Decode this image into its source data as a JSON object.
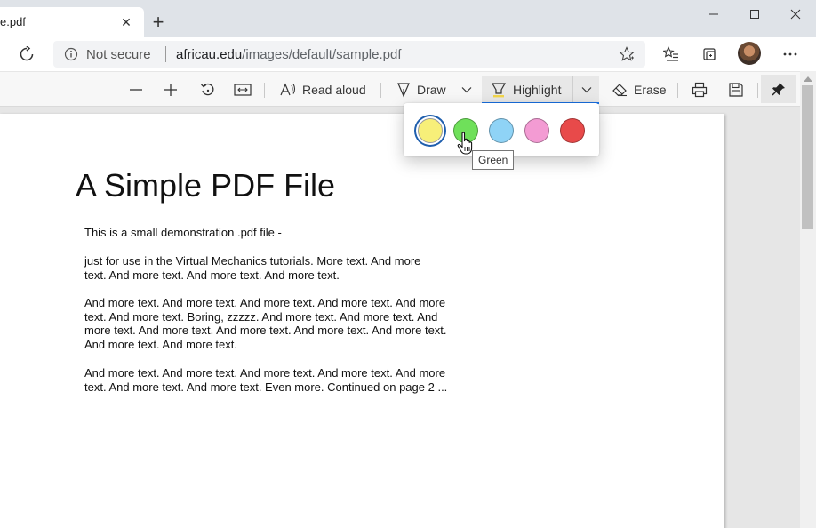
{
  "tab": {
    "title": "e.pdf",
    "close_label": "✕",
    "new_tab_label": "+"
  },
  "window": {
    "minimize": "—",
    "maximize": "☐",
    "close": "✕"
  },
  "address": {
    "security_text": "Not secure",
    "url_host": "africau.edu",
    "url_path": "/images/default/sample.pdf"
  },
  "pdf_toolbar": {
    "zoom_out": "—",
    "zoom_in": "+",
    "read_aloud": "Read aloud",
    "draw": "Draw",
    "highlight": "Highlight",
    "erase": "Erase"
  },
  "highlight_colors": [
    {
      "name": "Yellow",
      "hex": "#f7ef79",
      "selected": true
    },
    {
      "name": "Green",
      "hex": "#6fe05a",
      "selected": false
    },
    {
      "name": "Light blue",
      "hex": "#8fd3f6",
      "selected": false
    },
    {
      "name": "Pink",
      "hex": "#f39bd3",
      "selected": false
    },
    {
      "name": "Red",
      "hex": "#e84a4a",
      "selected": false
    }
  ],
  "tooltip": "Green",
  "document": {
    "title": "A Simple PDF File",
    "p1": "This is a small demonstration .pdf file -",
    "p2_l1": "just for use in the Virtual Mechanics tutorials. More text. And more",
    "p2_l2": "text. And more text. And more text. And more text.",
    "p3_l1": "And more text. And more text. And more text. And more text. And more",
    "p3_l2": "text. And more text. Boring, zzzzz. And more text. And more text. And",
    "p3_l3": "more text. And more text. And more text. And more text. And more text.",
    "p3_l4": "And more text. And more text.",
    "p4_l1": "And more text. And more text. And more text. And more text. And more",
    "p4_l2": "text. And more text. And more text. Even more. Continued on page 2 ..."
  },
  "icons": [
    "refresh-icon",
    "info-icon",
    "favorite-star-icon",
    "favorites-icon",
    "collections-icon",
    "more-icon",
    "rotate-icon",
    "fit-page-icon",
    "read-aloud-icon",
    "draw-icon",
    "highlight-icon",
    "erase-icon",
    "print-icon",
    "save-icon",
    "pin-icon",
    "chevron-down-icon"
  ]
}
